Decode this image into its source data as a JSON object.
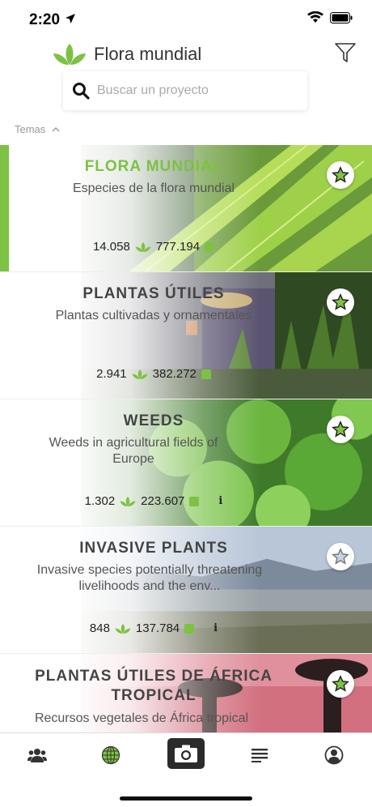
{
  "status": {
    "time": "2:20"
  },
  "header": {
    "title": "Flora mundial"
  },
  "search": {
    "placeholder": "Buscar un proyecto"
  },
  "section": {
    "label": "Temas"
  },
  "colors": {
    "accent": "#7dc242",
    "dark": "#2b2b2b"
  },
  "projects": [
    {
      "title": "FLORA MUNDIAL",
      "subtitle": "Especies de la flora mundial",
      "species": "14.058",
      "images": "777.194",
      "has_info": false,
      "selected": true,
      "favorite": true
    },
    {
      "title": "PLANTAS ÚTILES",
      "subtitle": "Plantas cultivadas y ornamentales",
      "species": "2.941",
      "images": "382.272",
      "has_info": false,
      "selected": false,
      "favorite": true
    },
    {
      "title": "WEEDS",
      "subtitle": "Weeds in agricultural fields of Europe",
      "species": "1.302",
      "images": "223.607",
      "has_info": true,
      "selected": false,
      "favorite": true
    },
    {
      "title": "INVASIVE PLANTS",
      "subtitle": "Invasive species potentially threatening livelihoods and the env...",
      "species": "848",
      "images": "137.784",
      "has_info": true,
      "selected": false,
      "favorite": false
    },
    {
      "title": "PLANTAS ÚTILES DE ÁFRICA TROPICAL",
      "subtitle": "Recursos vegetales de África tropical",
      "species": "",
      "images": "",
      "has_info": false,
      "selected": false,
      "favorite": true
    }
  ],
  "tabs": [
    {
      "icon": "community-icon"
    },
    {
      "icon": "globe-icon"
    },
    {
      "icon": "camera-icon"
    },
    {
      "icon": "list-icon"
    },
    {
      "icon": "profile-icon"
    }
  ]
}
